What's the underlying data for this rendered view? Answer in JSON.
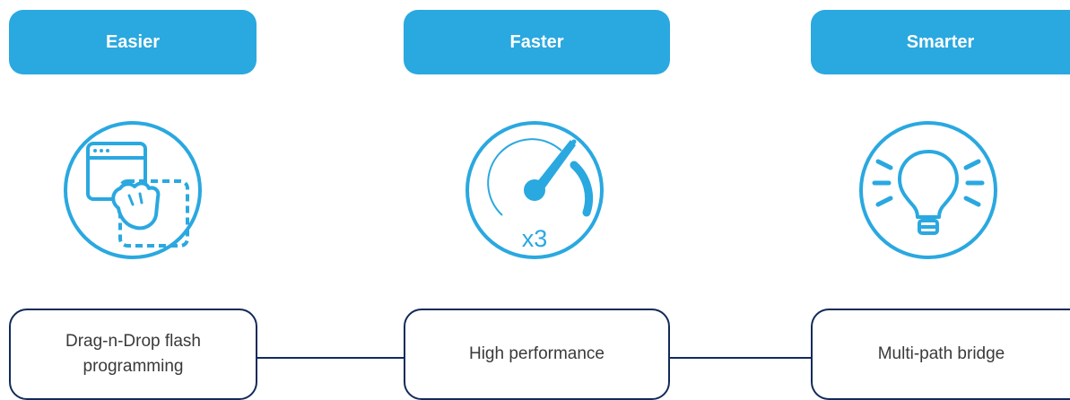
{
  "colors": {
    "accent": "#2aa8e0",
    "outline": "#132a5a",
    "text": "#3a3a3a",
    "background": "#ffffff"
  },
  "features": [
    {
      "title": "Easier",
      "icon": "drag-drop-window-icon",
      "description": "Drag-n-Drop flash programming"
    },
    {
      "title": "Faster",
      "icon": "speedometer-icon",
      "icon_text": "x3",
      "description": "High performance"
    },
    {
      "title": "Smarter",
      "icon": "lightbulb-icon",
      "description": "Multi-path bridge"
    }
  ]
}
